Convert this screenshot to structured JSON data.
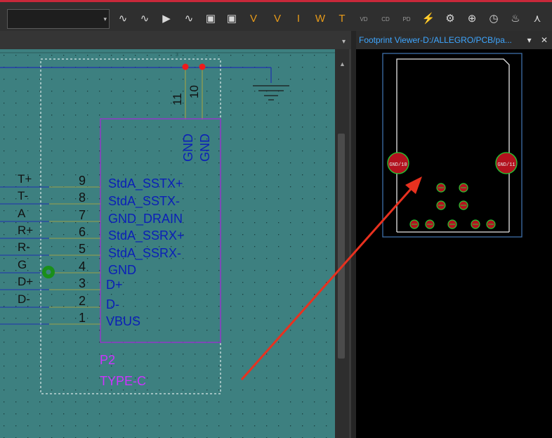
{
  "toolbar": {
    "combo_value": "",
    "icons": [
      "add-net-icon",
      "net-icon",
      "play-icon",
      "wave-icon",
      "chip-search-icon",
      "chip-add-icon",
      "probe-v-icon",
      "probe-v-alt-icon",
      "probe-i-icon",
      "probe-w-icon",
      "probe-t-icon",
      "vd-icon",
      "cd-icon",
      "pd-icon",
      "lightning-icon",
      "settings-icon",
      "target-icon",
      "time-icon",
      "flame-icon",
      "axis-icon"
    ],
    "labels": {
      "vd": "VD",
      "cd": "CD",
      "pd": "PD"
    }
  },
  "footprint_viewer": {
    "title": "Footprint Viewer-D:/ALLEGRO/PCB/pa...",
    "pin_label": "▾",
    "close_label": "✕",
    "pads": {
      "left": "GND/10",
      "right": "GND/11"
    }
  },
  "schematic": {
    "top_ruler": "3",
    "top_pins": [
      "11",
      "10"
    ],
    "top_pin_names": [
      "GND",
      "GND"
    ],
    "left_nets": [
      "T+",
      "T-",
      "A",
      "R+",
      "R-",
      "G",
      "D+",
      "D-"
    ],
    "pin_numbers": [
      "9",
      "8",
      "7",
      "6",
      "5",
      "4",
      "3",
      "2",
      "1"
    ],
    "pin_names": [
      "StdA_SSTX+",
      "StdA_SSTX-",
      "GND_DRAIN",
      "StdA_SSRX+",
      "StdA_SSRX-",
      "GND",
      "D+",
      "D-",
      "VBUS"
    ],
    "refdes": "P2",
    "part_value": "TYPE-C"
  },
  "colors": {
    "schematic_bg": "#3d8080",
    "pin_text": "#0b1fb8",
    "component_outline": "#9933cc",
    "refdes": "#cc33ff",
    "arrow": "#e8311f",
    "footprint_pad": "#22cc33",
    "footprint_outline": "#3d6fa8"
  }
}
